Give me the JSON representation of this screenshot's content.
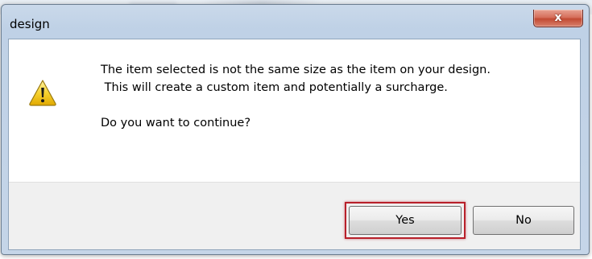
{
  "window": {
    "title": "design",
    "close_glyph": "x"
  },
  "message": {
    "line1": "The item selected is not the same size as the item on your design.",
    "line2": " This will create a custom item and potentially a surcharge.",
    "question": "Do you want to continue?"
  },
  "icons": {
    "message_icon": "warning-icon",
    "close_icon": "close-icon"
  },
  "buttons": {
    "yes_label": "Yes",
    "no_label": "No"
  },
  "colors": {
    "highlight_border": "#b8202a",
    "close_button": "#c24a33",
    "warning_yellow": "#f5c518"
  }
}
